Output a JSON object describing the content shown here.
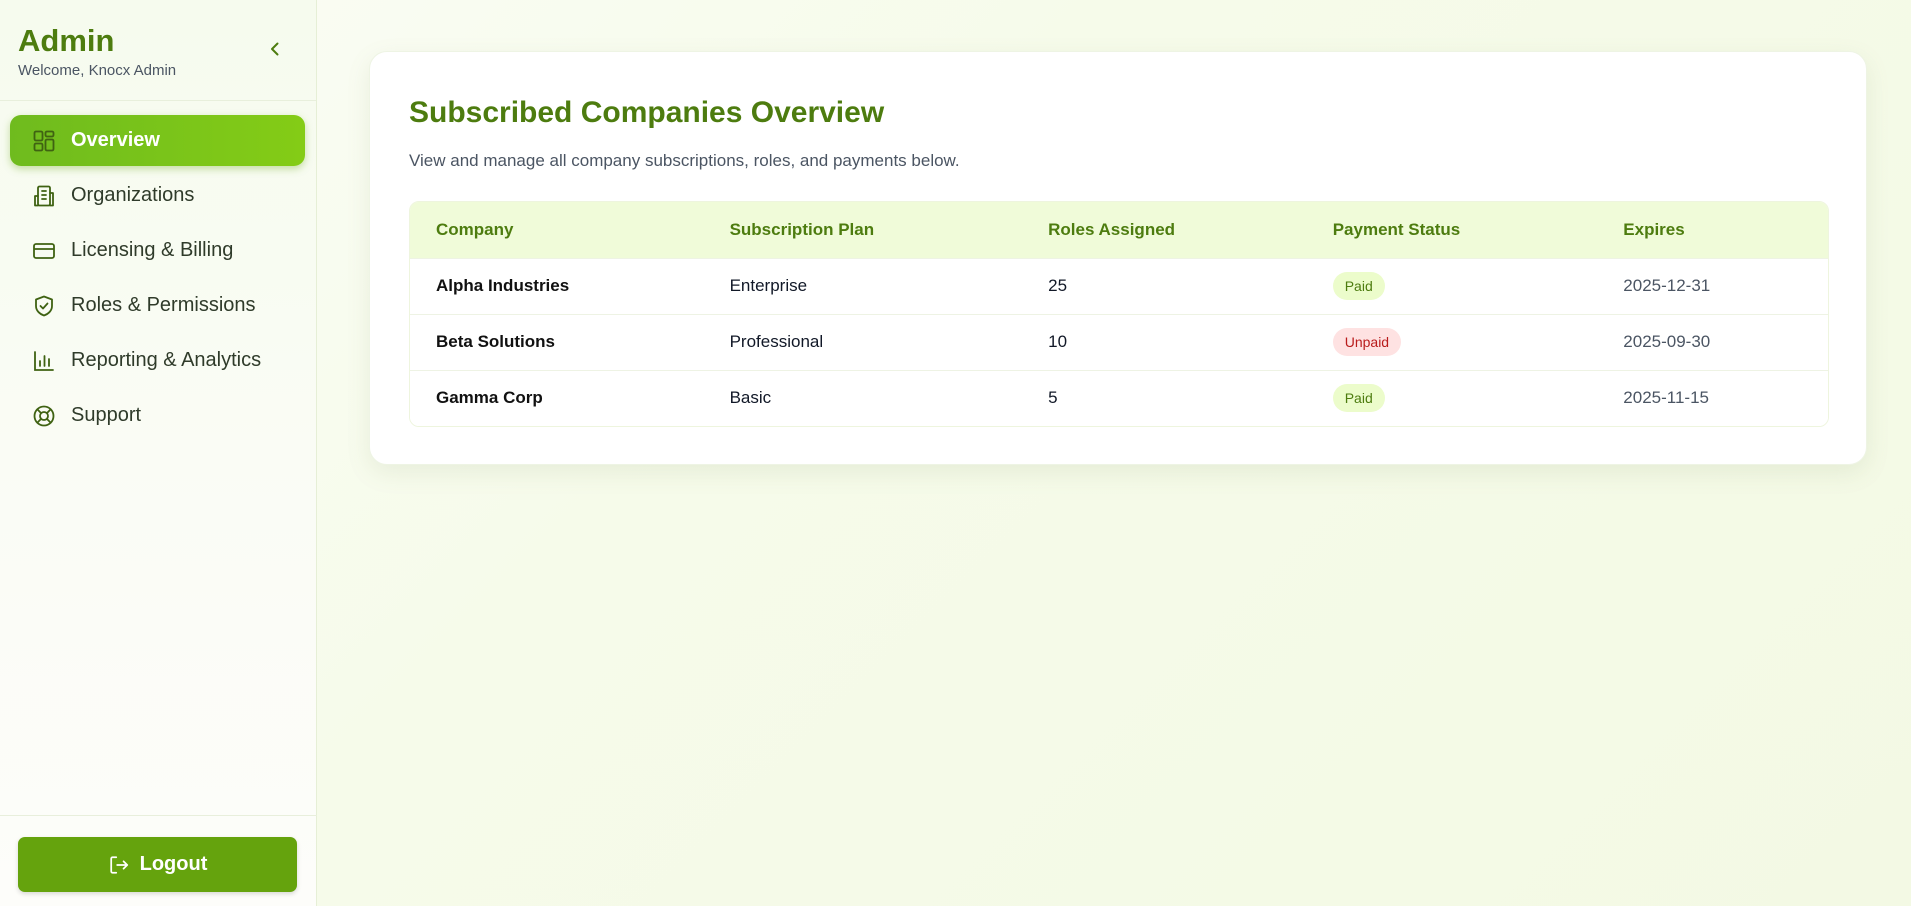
{
  "sidebar": {
    "title": "Admin",
    "welcome": "Welcome, Knocx Admin",
    "items": [
      {
        "label": "Overview",
        "icon": "dashboard-icon",
        "active": true
      },
      {
        "label": "Organizations",
        "icon": "building-icon",
        "active": false
      },
      {
        "label": "Licensing & Billing",
        "icon": "credit-card-icon",
        "active": false
      },
      {
        "label": "Roles & Permissions",
        "icon": "shield-check-icon",
        "active": false
      },
      {
        "label": "Reporting & Analytics",
        "icon": "bar-chart-icon",
        "active": false
      },
      {
        "label": "Support",
        "icon": "lifebuoy-icon",
        "active": false
      }
    ],
    "logout_label": "Logout"
  },
  "main": {
    "title": "Subscribed Companies Overview",
    "description": "View and manage all company subscriptions, roles, and payments below.",
    "table": {
      "headers": [
        "Company",
        "Subscription Plan",
        "Roles Assigned",
        "Payment Status",
        "Expires"
      ],
      "rows": [
        {
          "company": "Alpha Industries",
          "plan": "Enterprise",
          "roles": "25",
          "status": "Paid",
          "expires": "2025-12-31"
        },
        {
          "company": "Beta Solutions",
          "plan": "Professional",
          "roles": "10",
          "status": "Unpaid",
          "expires": "2025-09-30"
        },
        {
          "company": "Gamma Corp",
          "plan": "Basic",
          "roles": "5",
          "status": "Paid",
          "expires": "2025-11-15"
        }
      ]
    }
  },
  "colors": {
    "brand": "#4d7c0f",
    "accent": "#84cc16",
    "button": "#65a30d",
    "paid_bg": "#ecfccb",
    "unpaid_bg": "#fee2e2",
    "unpaid_text": "#b91c1c"
  }
}
